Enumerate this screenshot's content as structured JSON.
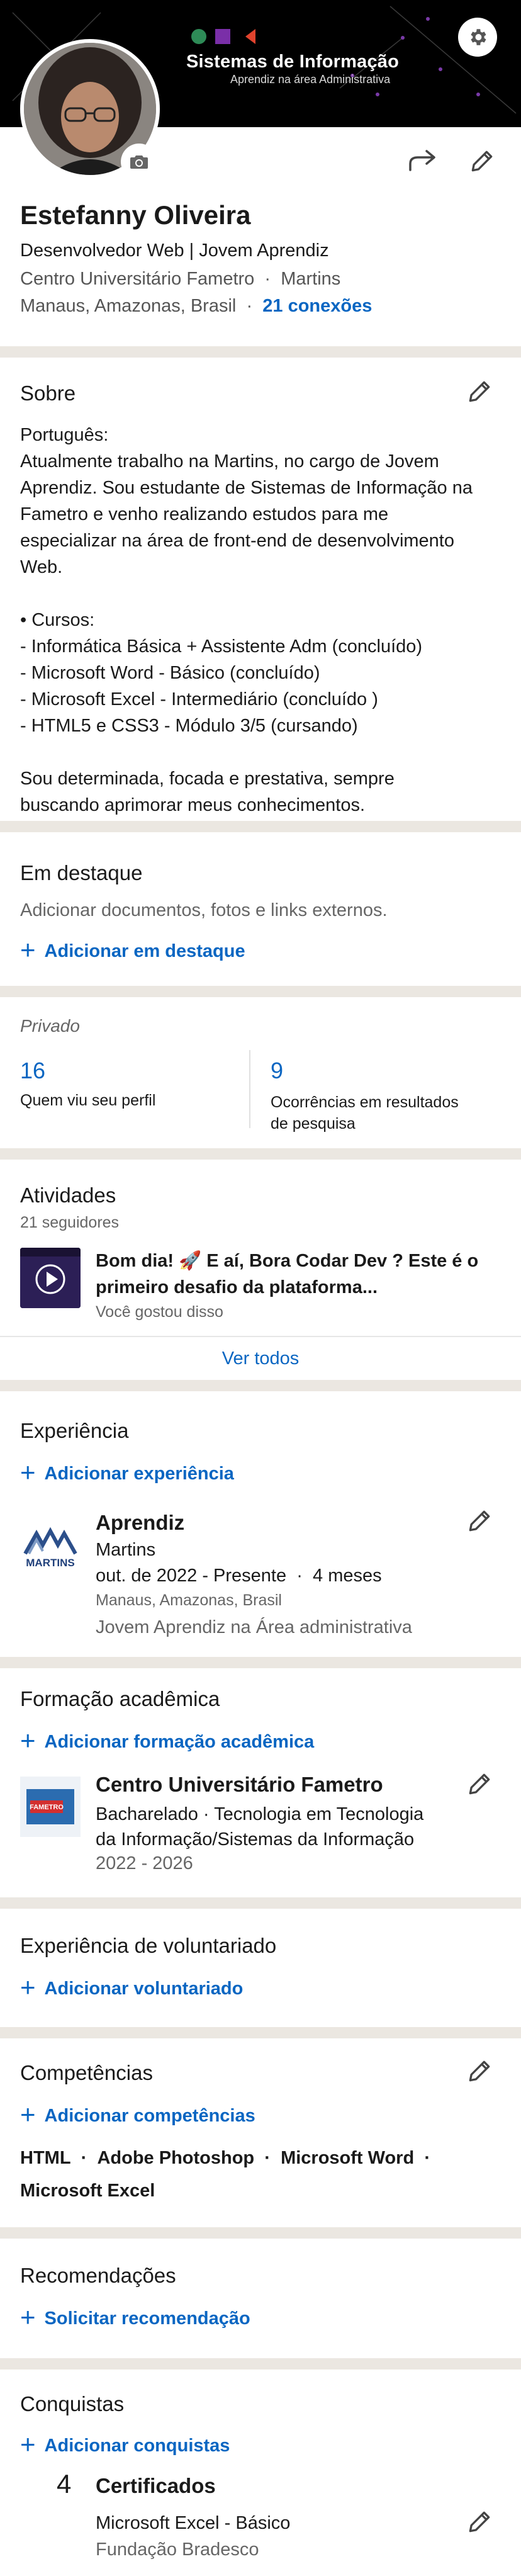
{
  "banner": {
    "title": "Sistemas de Informação",
    "subtitle": "Aprendiz na área Administrativa"
  },
  "profile": {
    "name": "Estefanny Oliveira",
    "headline": "Desenvolvedor Web | Jovem Aprendiz",
    "education": "Centro Universitário Fametro",
    "sep": "·",
    "company": "Martins",
    "location": "Manaus, Amazonas, Brasil",
    "connections": "21 conexões"
  },
  "about": {
    "title": "Sobre",
    "lines": [
      "Português:",
      "Atualmente trabalho na Martins, no cargo de Jovem",
      "Aprendiz. Sou estudante de Sistemas de Informação na",
      "Fametro e venho realizando estudos para me",
      "especializar na área de front-end de desenvolvimento",
      "Web.",
      "",
      "• Cursos:",
      "- Informática Básica + Assistente Adm (concluído)",
      "- Microsoft Word - Básico (concluído)",
      "- Microsoft Excel - Intermediário (concluído )",
      "- HTML5 e CSS3 - Módulo 3/5 (cursando)",
      "",
      "Sou determinada, focada e prestativa, sempre",
      "buscando aprimorar meus conhecimentos."
    ]
  },
  "featured": {
    "title": "Em destaque",
    "description": "Adicionar documentos, fotos e links externos.",
    "add_label": "Adicionar em destaque"
  },
  "analytics": {
    "label": "Privado",
    "views_count": "16",
    "views_label": "Quem viu seu perfil",
    "search_count": "9",
    "search_label_1": "Ocorrências em resultados",
    "search_label_2": "de pesquisa"
  },
  "activity": {
    "title": "Atividades",
    "followers": "21 seguidores",
    "post_line_1": "Bom dia! 🚀 E aí, Bora Codar Dev ? Este é o",
    "post_line_2": "primeiro desafio da plataforma...",
    "post_meta": "Você gostou disso",
    "see_all": "Ver todos"
  },
  "experience": {
    "title": "Experiência",
    "add_label": "Adicionar experiência",
    "logo_text": "MARTINS",
    "role": "Aprendiz",
    "company": "Martins",
    "dates": "out. de 2022 - Presente",
    "sep": "·",
    "duration": "4 meses",
    "location": "Manaus, Amazonas, Brasil",
    "description": "Jovem Aprendiz na Área administrativa"
  },
  "education": {
    "title": "Formação acadêmica",
    "add_label": "Adicionar formação acadêmica",
    "logo_text": "FAMETRO",
    "school": "Centro Universitário Fametro",
    "degree_line_1": "Bacharelado  ·  Tecnologia em Tecnologia",
    "degree_line_2": "da Informação/Sistemas da Informação",
    "years": "2022 - 2026"
  },
  "volunteer": {
    "title": "Experiência de voluntariado",
    "add_label": "Adicionar voluntariado"
  },
  "skills": {
    "title": "Competências",
    "add_label": "Adicionar competências",
    "items": [
      "HTML",
      "Adobe Photoshop",
      "Microsoft Word",
      "Microsoft Excel"
    ],
    "sep": "·"
  },
  "recommendations": {
    "title": "Recomendações",
    "add_label": "Solicitar recomendação"
  },
  "accomplishments": {
    "title": "Conquistas",
    "add_label": "Adicionar conquistas",
    "cert_count": "4",
    "cert_title": "Certificados",
    "cert_name": "Microsoft Excel - Básico",
    "cert_issuer": "Fundação Bradesco"
  },
  "colors": {
    "accent": "#0a66c2",
    "divider": "#ebe7e1",
    "banner": "#000000"
  }
}
